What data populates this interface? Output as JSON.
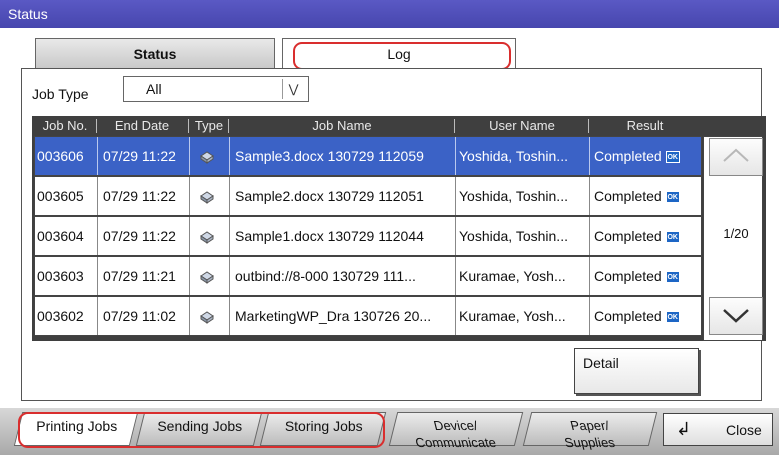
{
  "window": {
    "title": "Status"
  },
  "tabs": [
    {
      "label": "Status"
    },
    {
      "label": "Log"
    }
  ],
  "filter": {
    "label": "Job Type",
    "value": "All",
    "dropdown_icon": "double-chevron-down-icon"
  },
  "table": {
    "columns": [
      "Job No.",
      "End Date",
      "Type",
      "Job Name",
      "User Name",
      "Result"
    ],
    "rows": [
      {
        "job_no": "003606",
        "end_date": "07/29 11:22",
        "type_icon": "print-job-icon",
        "job_name": "Sample3.docx 130729 112059",
        "user": "Yoshida, Toshin...",
        "result": "Completed",
        "badge": "OK",
        "selected": true
      },
      {
        "job_no": "003605",
        "end_date": "07/29 11:22",
        "type_icon": "print-job-icon",
        "job_name": "Sample2.docx 130729 112051",
        "user": "Yoshida, Toshin...",
        "result": "Completed",
        "badge": "OK",
        "selected": false
      },
      {
        "job_no": "003604",
        "end_date": "07/29 11:22",
        "type_icon": "print-job-icon",
        "job_name": "Sample1.docx 130729 112044",
        "user": "Yoshida, Toshin...",
        "result": "Completed",
        "badge": "OK",
        "selected": false
      },
      {
        "job_no": "003603",
        "end_date": "07/29 11:21",
        "type_icon": "print-job-icon",
        "job_name": "outbind://8-000 130729 111...",
        "user": "Kuramae, Yosh...",
        "result": "Completed",
        "badge": "OK",
        "selected": false
      },
      {
        "job_no": "003602",
        "end_date": "07/29 11:02",
        "type_icon": "print-job-icon",
        "job_name": "MarketingWP_Dra 130726 20...",
        "user": "Kuramae, Yosh...",
        "result": "Completed",
        "badge": "OK",
        "selected": false
      }
    ]
  },
  "pager": {
    "indicator": "1/20",
    "up_icon": "chevron-up-icon",
    "down_icon": "chevron-down-icon"
  },
  "detail_button": {
    "label": "Detail"
  },
  "bottom_tabs": [
    {
      "label": "Printing Jobs"
    },
    {
      "label": "Sending Jobs"
    },
    {
      "label": "Storing Jobs"
    },
    {
      "label_line1": "Device/",
      "label_line2": "Communicate"
    },
    {
      "label_line1": "Paper/",
      "label_line2": "Supplies"
    }
  ],
  "close_button": {
    "label": "Close",
    "icon": "return-arrow-icon"
  },
  "colors": {
    "title_bar": "#4746ae",
    "selected_row": "#3b62c6",
    "highlight_oval": "#d92e2e",
    "ok_badge": "#1d66c5"
  }
}
